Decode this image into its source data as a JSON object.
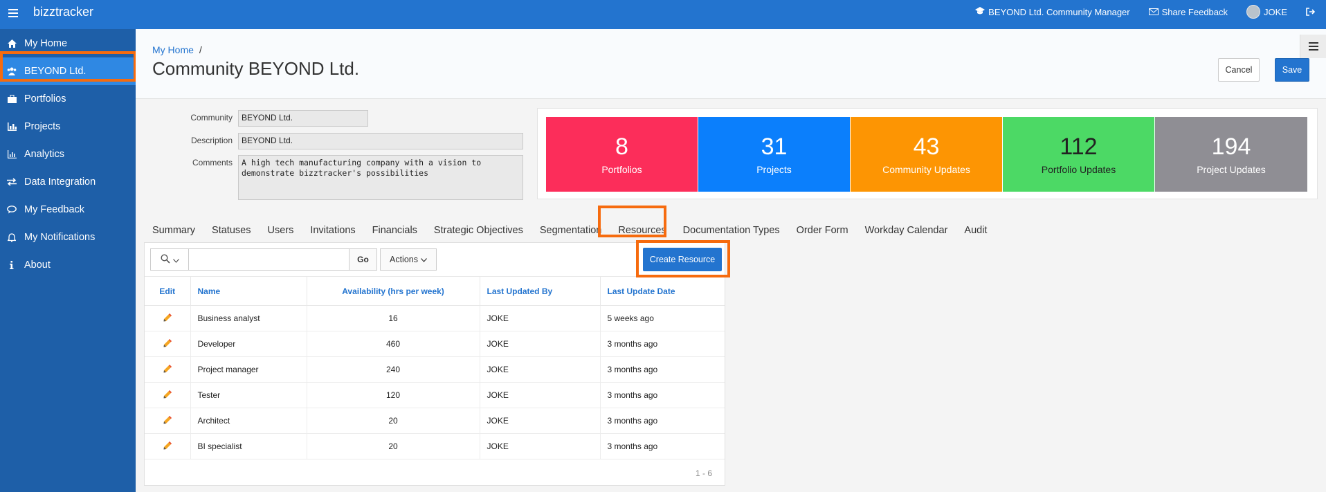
{
  "app": {
    "brand": "bizztracker",
    "community_role": "BEYOND Ltd. Community Manager",
    "feedback": "Share Feedback",
    "user": "JOKE"
  },
  "sidebar": {
    "items": [
      {
        "label": "My Home",
        "icon": "home-icon"
      },
      {
        "label": "BEYOND Ltd.",
        "icon": "users-icon"
      },
      {
        "label": "Portfolios",
        "icon": "briefcase-icon"
      },
      {
        "label": "Projects",
        "icon": "bar-chart-icon"
      },
      {
        "label": "Analytics",
        "icon": "line-chart-icon"
      },
      {
        "label": "Data Integration",
        "icon": "exchange-icon"
      },
      {
        "label": "My Feedback",
        "icon": "chat-icon"
      },
      {
        "label": "My Notifications",
        "icon": "bell-icon"
      },
      {
        "label": "About",
        "icon": "info-icon"
      }
    ]
  },
  "page": {
    "breadcrumb": "My Home",
    "breadcrumb_sep": "/",
    "title": "Community BEYOND Ltd.",
    "cancel": "Cancel",
    "save": "Save"
  },
  "form": {
    "community_label": "Community",
    "community_value": "BEYOND Ltd.",
    "description_label": "Description",
    "description_value": "BEYOND Ltd.",
    "comments_label": "Comments",
    "comments_value": "A high tech manufacturing company with a vision to demonstrate bizztracker's possibilities"
  },
  "stats": [
    {
      "num": "8",
      "label": "Portfolios",
      "color": "#fc2d5a"
    },
    {
      "num": "31",
      "label": "Projects",
      "color": "#0b7ffc"
    },
    {
      "num": "43",
      "label": "Community Updates",
      "color": "#fd9503"
    },
    {
      "num": "112",
      "label": "Portfolio Updates",
      "color": "#4cd965"
    },
    {
      "num": "194",
      "label": "Project Updates",
      "color": "#8f8e94"
    }
  ],
  "tabs": [
    "Summary",
    "Statuses",
    "Users",
    "Invitations",
    "Financials",
    "Strategic Objectives",
    "Segmentation",
    "Resources",
    "Documentation Types",
    "Order Form",
    "Workday Calendar",
    "Audit"
  ],
  "toolbar": {
    "search_value": "",
    "go": "Go",
    "actions": "Actions",
    "create": "Create Resource"
  },
  "table": {
    "headers": [
      "Edit",
      "Name",
      "Availability (hrs per week)",
      "Last Updated By",
      "Last Update Date"
    ],
    "rows": [
      [
        "Business analyst",
        "16",
        "JOKE",
        "5 weeks ago"
      ],
      [
        "Developer",
        "460",
        "JOKE",
        "3 months ago"
      ],
      [
        "Project manager",
        "240",
        "JOKE",
        "3 months ago"
      ],
      [
        "Tester",
        "120",
        "JOKE",
        "3 months ago"
      ],
      [
        "Architect",
        "20",
        "JOKE",
        "3 months ago"
      ],
      [
        "BI specialist",
        "20",
        "JOKE",
        "3 months ago"
      ]
    ],
    "pager": "1 - 6"
  },
  "colors": {
    "header": "#2374cf",
    "sidebar": "#1e5fa8",
    "highlight": "#f66b0e"
  }
}
